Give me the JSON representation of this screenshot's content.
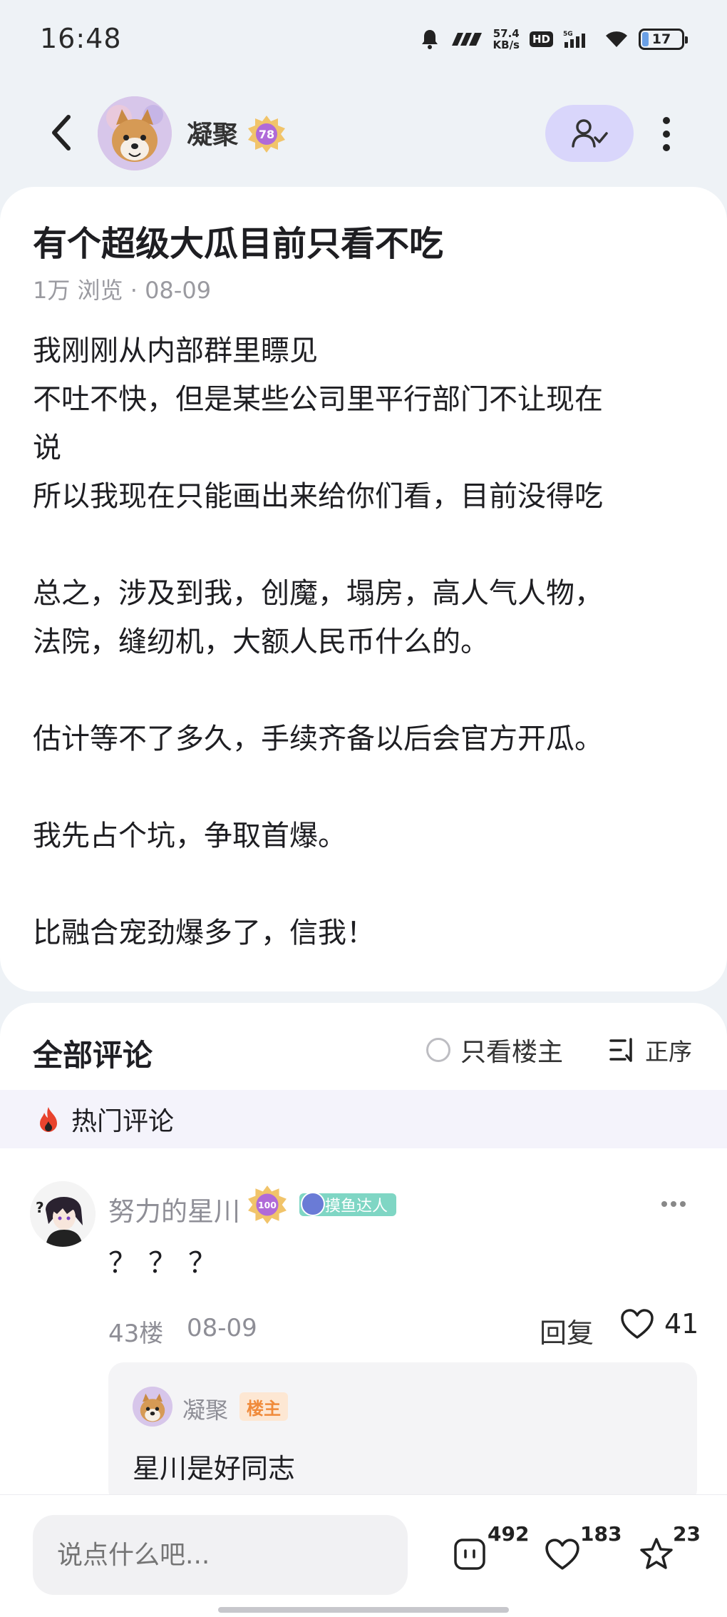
{
  "status_bar": {
    "time": "16:48",
    "net_speed_value": "57.4",
    "net_speed_unit": "KB/s",
    "hd_label": "HD",
    "signal_label": "5G",
    "battery": "17",
    "battery_level": 0.17
  },
  "header": {
    "author_name": "凝聚",
    "author_level": "78"
  },
  "post": {
    "title": "有个超级大瓜目前只看不吃",
    "views": "1万 浏览",
    "separator": "·",
    "date": "08-09",
    "body": [
      "我刚刚从内部群里瞟见",
      "不吐不快，但是某些公司里平行部门不让现在",
      "说",
      "所以我现在只能画出来给你们看，目前没得吃",
      "",
      "总之，涉及到我，创魔，塌房，高人气人物，",
      "法院，缝纫机，大额人民币什么的。",
      "",
      "估计等不了多久，手续齐备以后会官方开瓜。",
      "",
      "我先占个坑，争取首爆。",
      "",
      "比融合宠劲爆多了，信我！"
    ]
  },
  "comments": {
    "title": "全部评论",
    "owner_only_label": "只看楼主",
    "sort_label": "正序",
    "hot_label": "热门评论",
    "items": [
      {
        "user": "努力的星川",
        "level": "100",
        "tag": "摸鱼达人",
        "text": "？？？",
        "floor": "43楼",
        "date": "08-09",
        "reply_label": "回复",
        "likes": "41",
        "reply": {
          "user": "凝聚",
          "badge": "楼主",
          "text": "星川是好同志"
        }
      }
    ]
  },
  "bottom_bar": {
    "input_placeholder": "说点什么吧...",
    "comment_count": "492",
    "like_count": "183",
    "fav_count": "23"
  },
  "colors": {
    "accent": "#d9d6fb",
    "tag": "#7fd6c4",
    "owner_badge": "#fde7d3",
    "hot_bg": "#f4f3fb"
  }
}
